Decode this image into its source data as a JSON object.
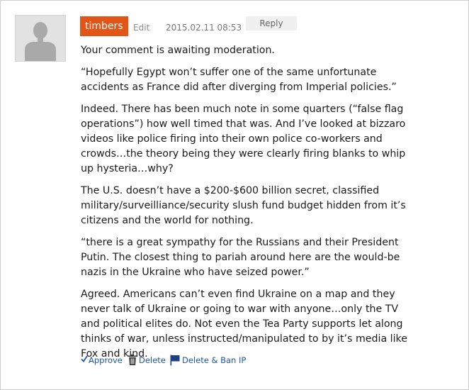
{
  "comment": {
    "author": "timbers",
    "edit_label": "Edit",
    "timestamp": "2015.02.11 08:53",
    "reply_label": "Reply",
    "moderation_notice": "Your comment is awaiting moderation.",
    "paragraphs": [
      "“Hopefully Egypt won’t suffer one of the same unfortunate accidents as France did after diverging from Imperial policies.”",
      "Indeed. There has been much note in some quarters (“false flag operations”) how well timed that was. And I’ve looked at bizzaro videos like police firing into their own police co-workers and crowds…the theory being they were clearly firing blanks to whip up hysteria…why?",
      "The U.S. doesn’t have a $200-$600 billion secret, classified military/surveilliance/security slush fund budget hidden from it’s citizens and the world for nothing.",
      "“there is a great sympathy for the Russians and their President Putin. The closest thing to pariah around here are the would-be nazis in the Ukraine who have seized power.”",
      "Agreed. Americans can’t even find Ukraine on a map and they never talk of Ukraine or going to war with anyone…only the TV and political elites do. Not even the Tea Party supports let along thinks of war, unless instructed/manipulated to by it’s media like Fox and kind."
    ]
  },
  "actions": {
    "approve_label": "Approve",
    "delete_label": "Delete",
    "ban_label": "Delete & Ban IP"
  },
  "icons": {
    "avatar": "default-user-silhouette-icon",
    "approve": "checkmark-icon",
    "delete": "trash-icon",
    "ban": "flag-icon"
  },
  "colors": {
    "author_badge": "#e35417",
    "action_link": "#1f56a8",
    "reply_button_bg": "#f0f0f0"
  }
}
